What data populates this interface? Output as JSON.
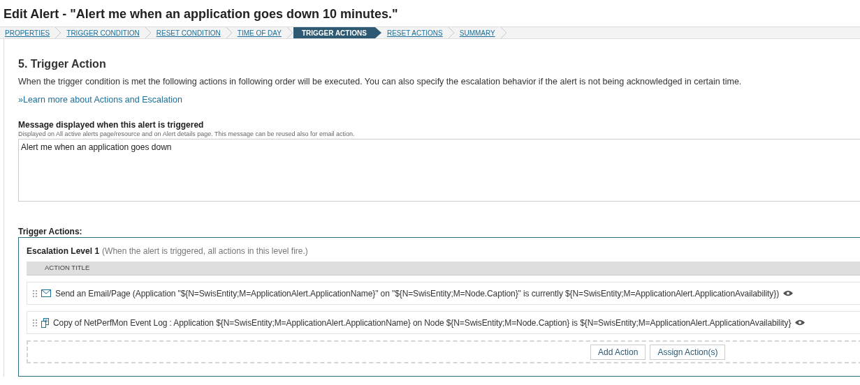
{
  "page_title": "Edit Alert - \"Alert me when an application goes down 10 minutes.\"",
  "steps": [
    {
      "label": "PROPERTIES",
      "selected": false
    },
    {
      "label": "TRIGGER CONDITION",
      "selected": false
    },
    {
      "label": "RESET CONDITION",
      "selected": false
    },
    {
      "label": "TIME OF DAY",
      "selected": false
    },
    {
      "label": "TRIGGER ACTIONS",
      "selected": true
    },
    {
      "label": "RESET ACTIONS",
      "selected": false
    },
    {
      "label": "SUMMARY",
      "selected": false
    }
  ],
  "section_title": "5. Trigger Action",
  "description": "When the trigger condition is met the following actions in following order will be executed. You can also specify the escalation behavior if the alert is not being acknowledged in certain time.",
  "learn_more_link": "»Learn more about Actions and Escalation",
  "message": {
    "label": "Message displayed when this alert is triggered",
    "hint": "Displayed on All active alerts page/resource and on Alert details page. This message can be reused also for email action.",
    "value": "Alert me when an application goes down"
  },
  "trigger_actions_label": "Trigger Actions:",
  "escalation": {
    "title": "Escalation Level 1",
    "note": "(When the alert is triggered, all actions in this level fire.)",
    "column": "ACTION TITLE",
    "actions": [
      {
        "kind": "email",
        "title": "Send an Email/Page (Application \"${N=SwisEntity;M=ApplicationAlert.ApplicationName}\" on \"${N=SwisEntity;M=Node.Caption}\" is currently ${N=SwisEntity;M=ApplicationAlert.ApplicationAvailability})"
      },
      {
        "kind": "eventlog",
        "title": "Copy of NetPerfMon Event Log : Application ${N=SwisEntity;M=ApplicationAlert.ApplicationName} on Node ${N=SwisEntity;M=Node.Caption} is ${N=SwisEntity;M=ApplicationAlert.ApplicationAvailability}"
      }
    ],
    "buttons": [
      "Add Action",
      "Assign Action(s)"
    ]
  }
}
